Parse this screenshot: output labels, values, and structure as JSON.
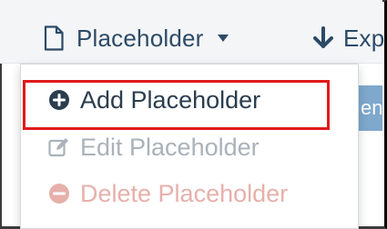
{
  "toolbar": {
    "placeholder_menu_label": "Placeholder",
    "export_label": "Exp",
    "icons": {
      "placeholder": "file-icon",
      "caret": "caret-down-icon",
      "export": "download-arrow-icon"
    }
  },
  "dropdown": {
    "items": [
      {
        "label": "Add Placeholder",
        "icon": "plus-circle-icon",
        "state": "enabled",
        "color": "#2b3d4f"
      },
      {
        "label": "Edit Placeholder",
        "icon": "edit-icon",
        "state": "disabled",
        "color": "#aab2ba"
      },
      {
        "label": "Delete Placeholder",
        "icon": "minus-circle-icon",
        "state": "disabled",
        "color": "#e7b0aa"
      }
    ],
    "highlighted_item": "Add Placeholder",
    "highlight_color": "#e01a1a"
  },
  "background_button": {
    "partial_label": "ene",
    "color": "#7ea8cc"
  },
  "colors": {
    "toolbar_bg": "#f3f5f7",
    "toolbar_text": "#2c4a66"
  }
}
